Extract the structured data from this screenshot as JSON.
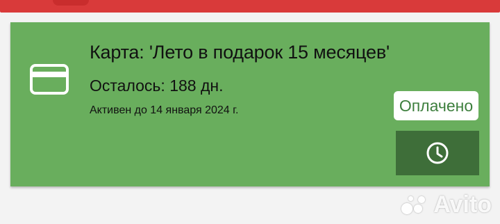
{
  "card": {
    "title": "Карта: 'Лето в подарок 15 месяцев'",
    "remaining": "Осталось: 188 дн.",
    "active_until": "Активен до 14 января 2024 г.",
    "status_label": "Оплачено",
    "icons": {
      "card": "credit-card-icon",
      "history": "clock-icon"
    }
  },
  "watermark": {
    "text": "Avito"
  },
  "colors": {
    "top_bar": "#d93a3a",
    "card_bg": "#69ae5d",
    "button_bg": "#3e6e39",
    "badge_text": "#3d7f3d"
  }
}
